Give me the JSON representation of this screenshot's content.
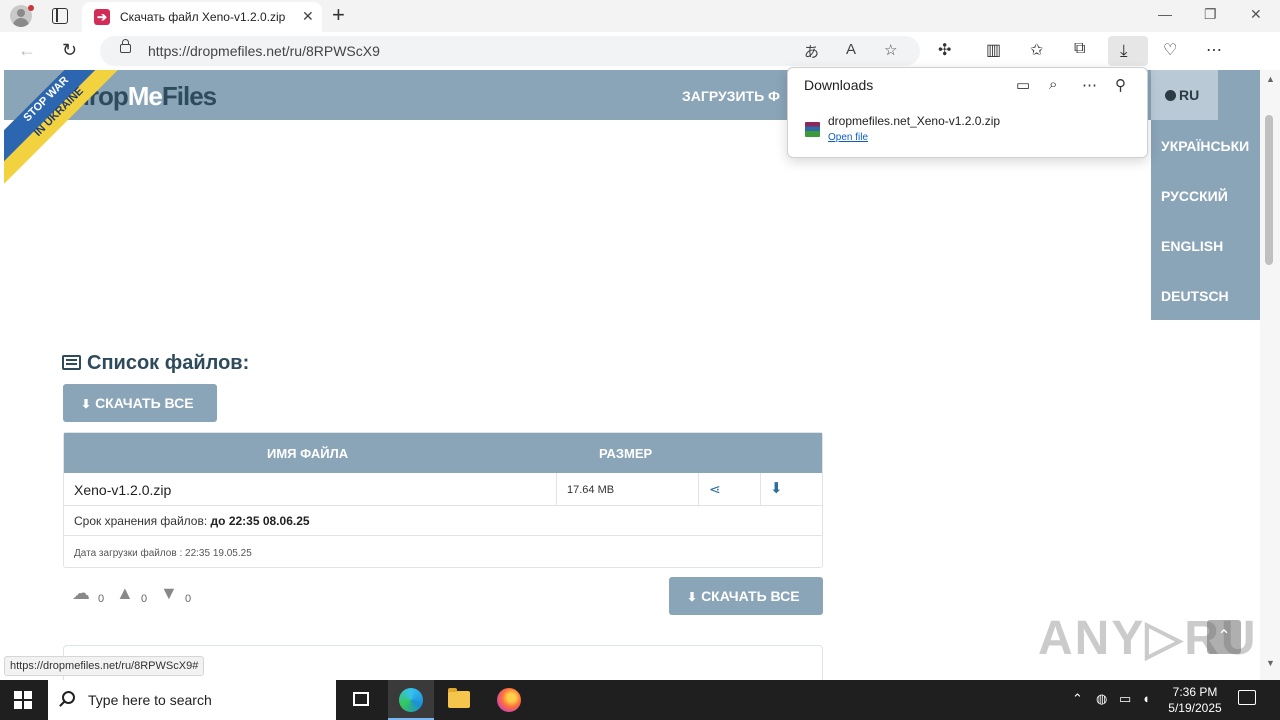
{
  "browser": {
    "tab_title": "Скачать файл Xeno-v1.2.0.zip",
    "url": "https://dropmefiles.net/ru/8RPWScX9",
    "status_url": "https://dropmefiles.net/ru/8RPWScX9#"
  },
  "downloads": {
    "title": "Downloads",
    "file_name": "dropmefiles.net_Xeno-v1.2.0.zip",
    "open_label": "Open file"
  },
  "site": {
    "logo_part1": "drop",
    "logo_part2": "Me",
    "logo_part3": "Files",
    "ribbon_line1": "STOP WAR",
    "ribbon_line2": "IN UKRAINE",
    "nav_upload": "ЗАГРУЗИТЬ Ф",
    "languages": {
      "current": "RU",
      "items": [
        "УКРАЇНСЬКИ",
        "РУССКИЙ",
        "ENGLISH",
        "DEUTSCH"
      ]
    },
    "files_title": "Список файлов:",
    "download_all": "СКАЧАТЬ ВСЕ",
    "table": {
      "col_name": "ИМЯ ФАЙЛА",
      "col_size": "РАЗМЕР",
      "file_name": "Xeno-v1.2.0.zip",
      "file_size": "17.64 MB",
      "keep_label": "Срок хранения файлов:",
      "keep_value": "до 22:35 08.06.25",
      "uploaded": "Дата загрузки файлов : 22:35 19.05.25"
    },
    "stats": {
      "downloads": "0",
      "likes": "0",
      "dislikes": "0"
    }
  },
  "watermark": "ANY▷RUN",
  "taskbar": {
    "search_placeholder": "Type here to search",
    "time": "7:36 PM",
    "date": "5/19/2025"
  }
}
